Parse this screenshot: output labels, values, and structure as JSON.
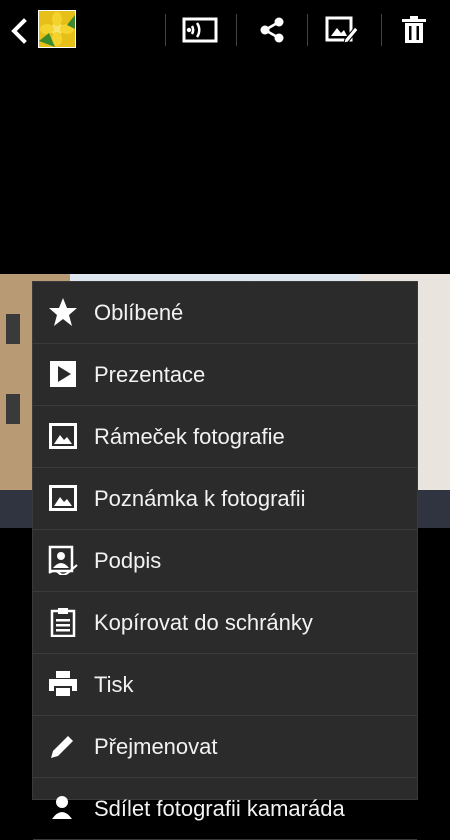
{
  "topbar": {
    "back_icon": "chevron-left-icon",
    "thumbnail_icon": "flower-thumbnail-icon",
    "actions": [
      {
        "name": "screen-mirroring-icon"
      },
      {
        "name": "share-icon"
      },
      {
        "name": "edit-image-icon"
      },
      {
        "name": "trash-icon"
      }
    ]
  },
  "menu": {
    "items": [
      {
        "label": "Oblíbené",
        "icon": "star-icon"
      },
      {
        "label": "Prezentace",
        "icon": "play-icon"
      },
      {
        "label": "Rámeček fotografie",
        "icon": "picture-frame-icon"
      },
      {
        "label": "Poznámka k fotografii",
        "icon": "photo-note-icon"
      },
      {
        "label": "Podpis",
        "icon": "signature-icon"
      },
      {
        "label": "Kopírovat do schránky",
        "icon": "clipboard-icon"
      },
      {
        "label": "Tisk",
        "icon": "printer-icon"
      },
      {
        "label": "Přejmenovat",
        "icon": "pencil-icon"
      },
      {
        "label": "Sdílet fotografii kamaráda",
        "icon": "share-friend-icon"
      }
    ]
  },
  "colors": {
    "menu_bg": "#2b2b2b",
    "divider": "#3b3b3b",
    "text": "#f2f2f2"
  }
}
